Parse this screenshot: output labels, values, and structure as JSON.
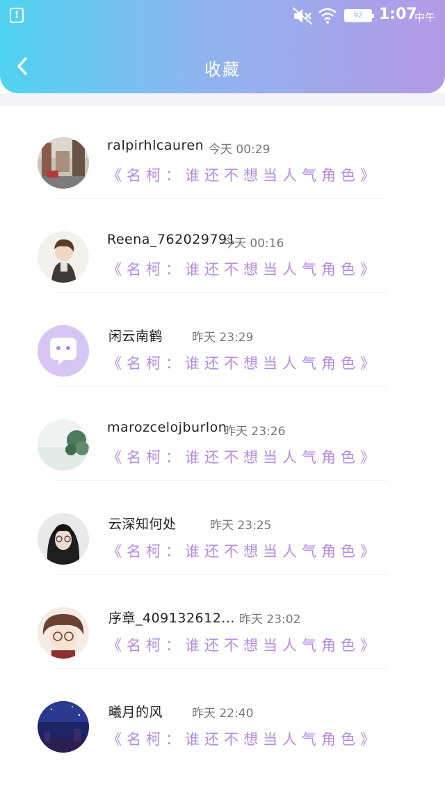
{
  "status_bar": {
    "notification_icon": "notification-icon",
    "battery_level": "92",
    "time": "1:07",
    "period": "中午"
  },
  "header": {
    "back_icon": "chevron-left-icon",
    "title": "收藏"
  },
  "colors": {
    "header_gradient_start": "#4fd3f0",
    "header_gradient_end": "#b49ae6",
    "post_title": "#b58be2",
    "username": "#222222",
    "timestamp": "#777777"
  },
  "favorites": [
    {
      "username": "ralpirhlcauren",
      "time": "今天 00:29",
      "post_title": "《名柯：谁还不想当人气角色》",
      "avatar": "street-photo-avatar"
    },
    {
      "username": "Reena_762029791",
      "time": "今天 00:16",
      "post_title": "《名柯：谁还不想当人气角色》",
      "avatar": "anime-boy-avatar"
    },
    {
      "username": "闲云南鹤",
      "time": "昨天 23:29",
      "post_title": "《名柯：谁还不想当人气角色》",
      "avatar": "default-chat-avatar"
    },
    {
      "username": "marozcelojburlon",
      "time": "昨天 23:26",
      "post_title": "《名柯：谁还不想当人气角色》",
      "avatar": "plant-photo-avatar"
    },
    {
      "username": "云深知何处",
      "time": "昨天 23:25",
      "post_title": "《名柯：谁还不想当人气角色》",
      "avatar": "girl-photo-avatar"
    },
    {
      "username": "序章_409132612...",
      "time": "昨天 23:02",
      "post_title": "《名柯：谁还不想当人气角色》",
      "avatar": "anime-glasses-avatar"
    },
    {
      "username": "曦月的风",
      "time": "昨天 22:40",
      "post_title": "《名柯：谁还不想当人气角色》",
      "avatar": "night-sky-avatar"
    }
  ]
}
